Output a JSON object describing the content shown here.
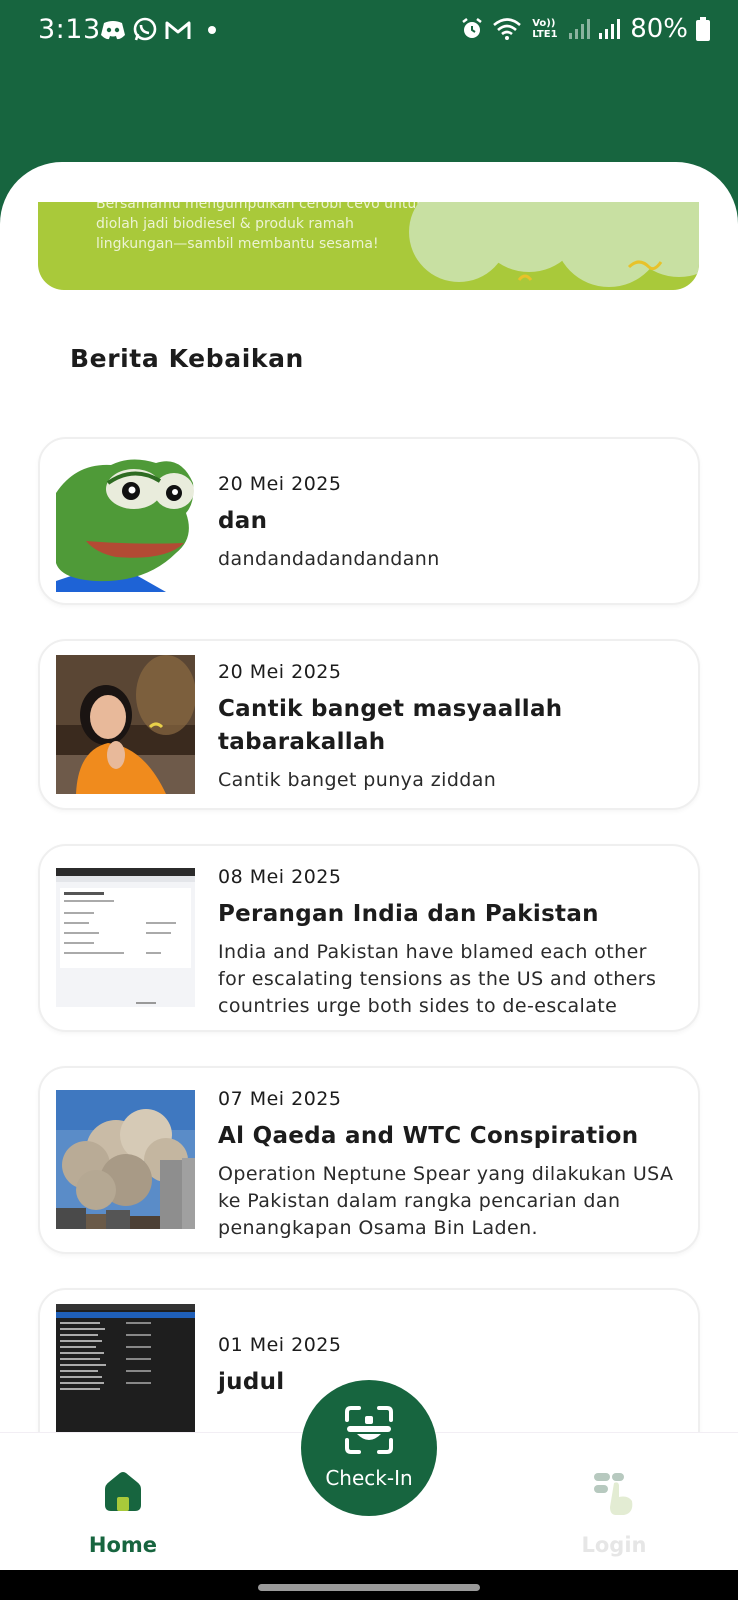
{
  "status_bar": {
    "time": "3:13",
    "battery": "80%",
    "network_label": "Vo)) LTE1"
  },
  "banner": {
    "text": "Bersamamu mengumpulkan cerobi cevo untuk diolah jadi biodiesel & produk ramah lingkungan—sambil membantu sesama!"
  },
  "section": {
    "title": "Berita Kebaikan"
  },
  "news": [
    {
      "date": "20 Mei 2025",
      "title": "dan",
      "excerpt": "dandandadandandann",
      "thumb": "frog-meme-image"
    },
    {
      "date": "20 Mei 2025",
      "title": "Cantik banget masyaallah tabarakallah",
      "excerpt": "Cantik banget punya ziddan",
      "thumb": "girl-praying-photo"
    },
    {
      "date": "08 Mei 2025",
      "title": "Perangan India dan Pakistan",
      "excerpt": "India and Pakistan have blamed each other for escalating tensions as the US and others countries urge both sides to de-escalate",
      "thumb": "web-form-screenshot"
    },
    {
      "date": "07 Mei 2025",
      "title": "Al Qaeda and WTC Conspiration",
      "excerpt": "Operation Neptune Spear yang dilakukan USA ke Pakistan dalam rangka pencarian dan penangkapan Osama Bin Laden.",
      "thumb": "smoke-tower-photo"
    },
    {
      "date": "01 Mei 2025",
      "title": "judul",
      "excerpt": "",
      "thumb": "file-list-screenshot"
    }
  ],
  "bottom_nav": {
    "home": "Home",
    "checkin": "Check-In",
    "login": "Login"
  },
  "colors": {
    "primary_green": "#17653f",
    "banner_lime": "#a9c93a",
    "login_inactive": "#e6e6e6"
  }
}
